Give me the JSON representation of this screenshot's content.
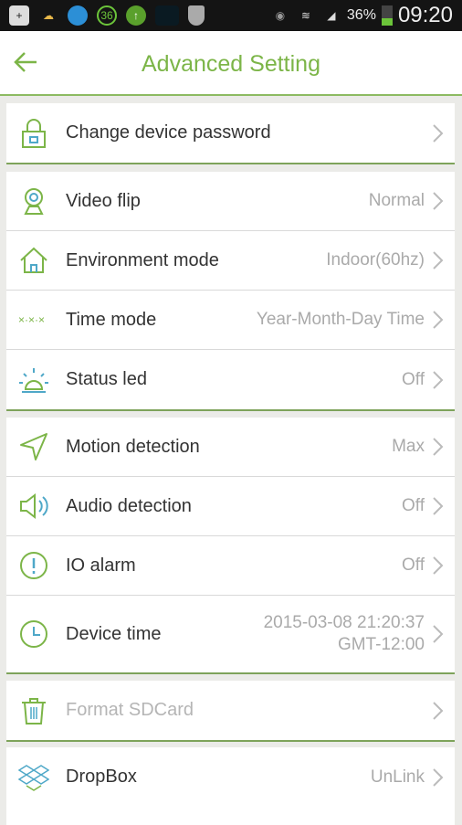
{
  "status_bar": {
    "battery_percent": "36%",
    "battery_level": 0.36,
    "time": "09:20",
    "signal_icons": [
      "add-icon",
      "weather-icon",
      "browser-icon",
      "badge-36-icon",
      "upload-icon",
      "app-icon",
      "shield-icon",
      "eye-icon",
      "wifi-icon",
      "signal-icon"
    ],
    "badge": "36"
  },
  "header": {
    "title": "Advanced Setting",
    "back_icon": "arrow-left-icon"
  },
  "colors": {
    "accent": "#7cb548",
    "icon_blue": "#4fa8c8",
    "background": "#ebebe8"
  },
  "groups": [
    [
      {
        "label": "Change device password",
        "value": "",
        "icon": "lock-icon"
      }
    ],
    [
      {
        "label": "Video flip",
        "value": "Normal",
        "icon": "camera-icon"
      },
      {
        "label": "Environment mode",
        "value": "Indoor(60hz)",
        "icon": "home-icon"
      },
      {
        "label": "Time mode",
        "value": "Year-Month-Day Time",
        "icon": "time-format-icon"
      },
      {
        "label": "Status led",
        "value": "Off",
        "icon": "led-icon"
      }
    ],
    [
      {
        "label": "Motion detection",
        "value": "Max",
        "icon": "motion-icon"
      },
      {
        "label": "Audio detection",
        "value": "Off",
        "icon": "speaker-icon"
      },
      {
        "label": "IO alarm",
        "value": "Off",
        "icon": "alert-icon"
      },
      {
        "label": "Device time",
        "value": "2015-03-08 21:20:37",
        "value2": "GMT-12:00",
        "icon": "clock-icon"
      }
    ],
    [
      {
        "label": "Format SDCard",
        "value": "",
        "icon": "trash-icon",
        "disabled": true
      }
    ],
    [
      {
        "label": "DropBox",
        "value": "UnLink",
        "icon": "dropbox-icon"
      }
    ]
  ]
}
